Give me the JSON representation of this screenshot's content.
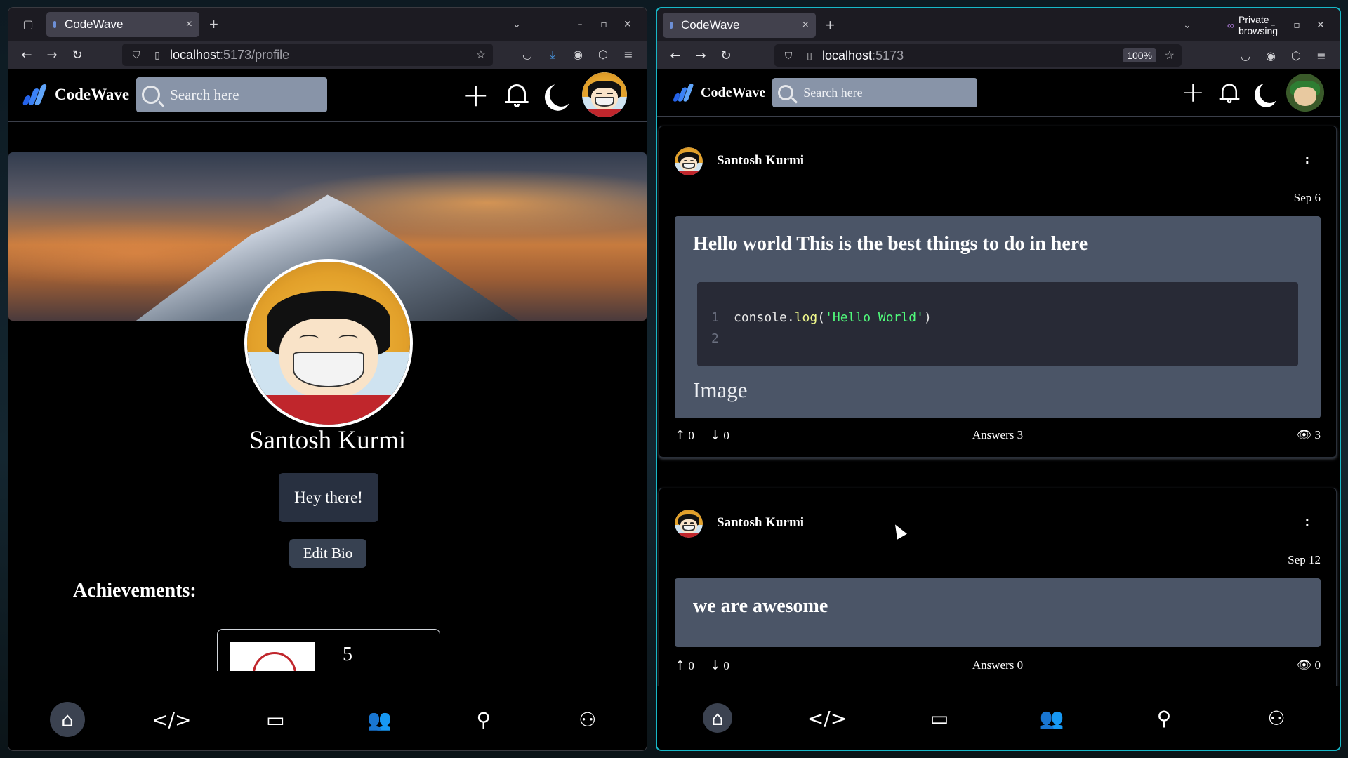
{
  "left_window": {
    "tab_title": "CodeWave",
    "url_host": "localhost",
    "url_path": ":5173/profile",
    "app": {
      "brand": "CodeWave",
      "search_placeholder": "Search here"
    },
    "profile": {
      "name": "Santosh Kurmi",
      "bio": "Hey there!",
      "edit_bio_label": "Edit Bio",
      "achievements_title": "Achievements:",
      "achievement_count": "5"
    }
  },
  "right_window": {
    "tab_title": "CodeWave",
    "private_label": "Private browsing",
    "url_host": "localhost",
    "url_path": ":5173",
    "zoom": "100%",
    "app": {
      "brand": "CodeWave",
      "search_placeholder": "Search here"
    },
    "posts": [
      {
        "author": "Santosh Kurmi",
        "more": ":",
        "date": "Sep 6",
        "title": "Hello world This is the best things to do in here",
        "code_line_numbers": [
          "1",
          "2"
        ],
        "code_obj": "console.",
        "code_fn": "log",
        "code_open": "(",
        "code_str": "'Hello World'",
        "code_close": ")",
        "image_label": "Image",
        "upvotes": "0",
        "downvotes": "0",
        "answers": "Answers 3",
        "views": "3"
      },
      {
        "author": "Santosh Kurmi",
        "more": ":",
        "date": "Sep 12",
        "title": "we are awesome",
        "upvotes": "0",
        "downvotes": "0",
        "answers": "Answers 0",
        "views": "0"
      }
    ]
  },
  "icons": {
    "up": "↑",
    "down": "↓",
    "eye": "👁",
    "plus": "+",
    "home": "⌂",
    "code": "</>",
    "chat": "▭",
    "users": "👥",
    "search": "⚲",
    "people": "⚇",
    "back": "←",
    "forward": "→",
    "reload": "↻",
    "close": "×",
    "newtab": "+",
    "chevron": "⌄",
    "star": "☆",
    "shield": "⛉",
    "page": "▯"
  }
}
